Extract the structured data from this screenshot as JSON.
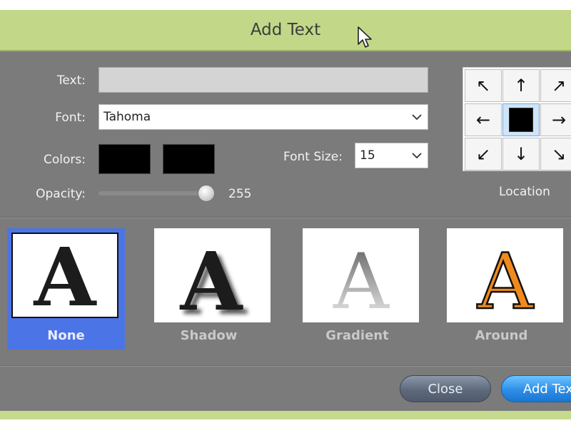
{
  "dialog": {
    "title": "Add Text"
  },
  "form": {
    "text_label": "Text:",
    "text_value": "",
    "font_label": "Font:",
    "font_value": "Tahoma",
    "colors_label": "Colors:",
    "color1": "#000000",
    "color2": "#000000",
    "font_size_label": "Font Size:",
    "font_size_value": "15",
    "opacity_label": "Opacity:",
    "opacity_value": "255",
    "opacity_fraction": 1.0
  },
  "location": {
    "label": "Location",
    "cells": [
      {
        "name": "top-left",
        "glyph": "↖"
      },
      {
        "name": "top",
        "glyph": "↑"
      },
      {
        "name": "top-right",
        "glyph": "↗"
      },
      {
        "name": "left",
        "glyph": "←"
      },
      {
        "name": "center",
        "glyph": ""
      },
      {
        "name": "right",
        "glyph": "→"
      },
      {
        "name": "bottom-left",
        "glyph": "↙"
      },
      {
        "name": "bottom",
        "glyph": "↓"
      },
      {
        "name": "bottom-right",
        "glyph": "↘"
      }
    ],
    "selected": "center"
  },
  "styles": [
    {
      "name": "None",
      "selected": true
    },
    {
      "name": "Shadow",
      "selected": false
    },
    {
      "name": "Gradient",
      "selected": false
    },
    {
      "name": "Around",
      "selected": false
    }
  ],
  "buttons": {
    "close": "Close",
    "add": "Add Text"
  },
  "colors": {
    "title_bar": "#c2d888",
    "dialog_bg": "#7b7b7b",
    "selected": "#4b74e6",
    "around_fill": "#f08a1c"
  }
}
